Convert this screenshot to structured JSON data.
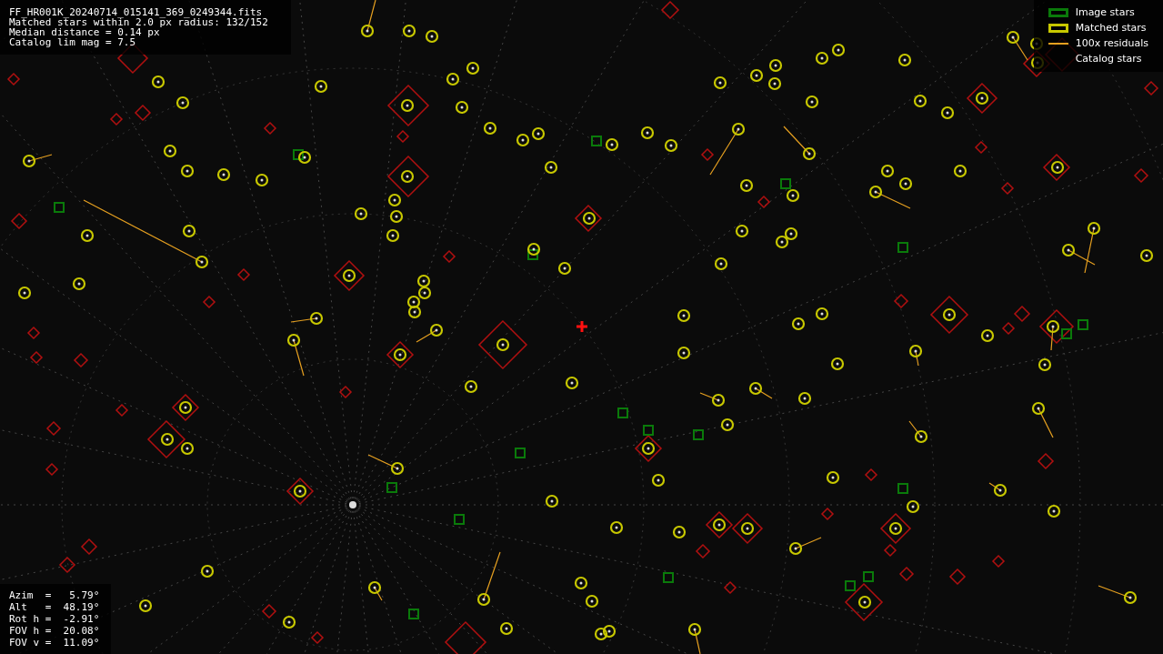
{
  "header_lines": [
    "FF_HR001K_20240714_015141_369_0249344.fits",
    "Matched stars within 2.0 px radius: 132/152",
    "Median distance = 0.14 px",
    "Catalog lim mag = 7.5"
  ],
  "legend": [
    {
      "kind": "image",
      "label": "Image stars"
    },
    {
      "kind": "matched",
      "label": "Matched stars"
    },
    {
      "kind": "residual",
      "label": "100x residuals"
    },
    {
      "kind": "catalog",
      "label": "Catalog stars"
    }
  ],
  "pointing_lines": [
    "Azim  =   5.79°",
    "Alt   =  48.19°",
    "Rot h =  -2.91°",
    "FOV h =  20.08°",
    "FOV v =  11.09°"
  ]
}
